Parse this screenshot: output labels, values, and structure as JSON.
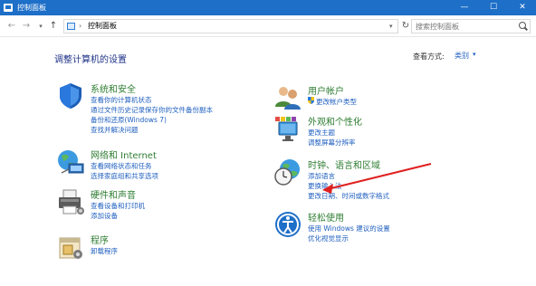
{
  "window": {
    "title": "控制面板",
    "min": "—",
    "max": "☐",
    "close": "✕"
  },
  "address": {
    "separator": "›",
    "crumb": "控制面板",
    "search_placeholder": "搜索控制面板"
  },
  "header": {
    "heading": "调整计算机的设置",
    "viewby_label": "查看方式:",
    "viewby_value": "类别",
    "viewby_caret": "▾"
  },
  "categories": [
    {
      "title": "系统和安全",
      "links": [
        "查看你的计算机状态",
        "通过文件历史记录保存你的文件备份副本",
        "备份和还原(Windows 7)",
        "查找并解决问题"
      ],
      "icon": "shield-icon"
    },
    {
      "title": "网络和 Internet",
      "links": [
        "查看网络状态和任务",
        "选择家庭组和共享选项"
      ],
      "icon": "network-icon"
    },
    {
      "title": "硬件和声音",
      "links": [
        "查看设备和打印机",
        "添加设备"
      ],
      "icon": "printer-icon"
    },
    {
      "title": "程序",
      "links": [
        "卸载程序"
      ],
      "icon": "programs-icon"
    },
    {
      "title": "用户帐户",
      "links": [
        "更改帐户类型"
      ],
      "icon": "users-icon"
    },
    {
      "title": "外观和个性化",
      "links": [
        "更改主题",
        "调整屏幕分辨率"
      ],
      "icon": "appearance-icon"
    },
    {
      "title": "时钟、语言和区域",
      "links": [
        "添加语言",
        "更换输入法",
        "更改日期、时间或数字格式"
      ],
      "icon": "clock-globe-icon"
    },
    {
      "title": "轻松使用",
      "links": [
        "使用 Windows 建议的设置",
        "优化视觉显示"
      ],
      "icon": "ease-of-access-icon"
    }
  ]
}
